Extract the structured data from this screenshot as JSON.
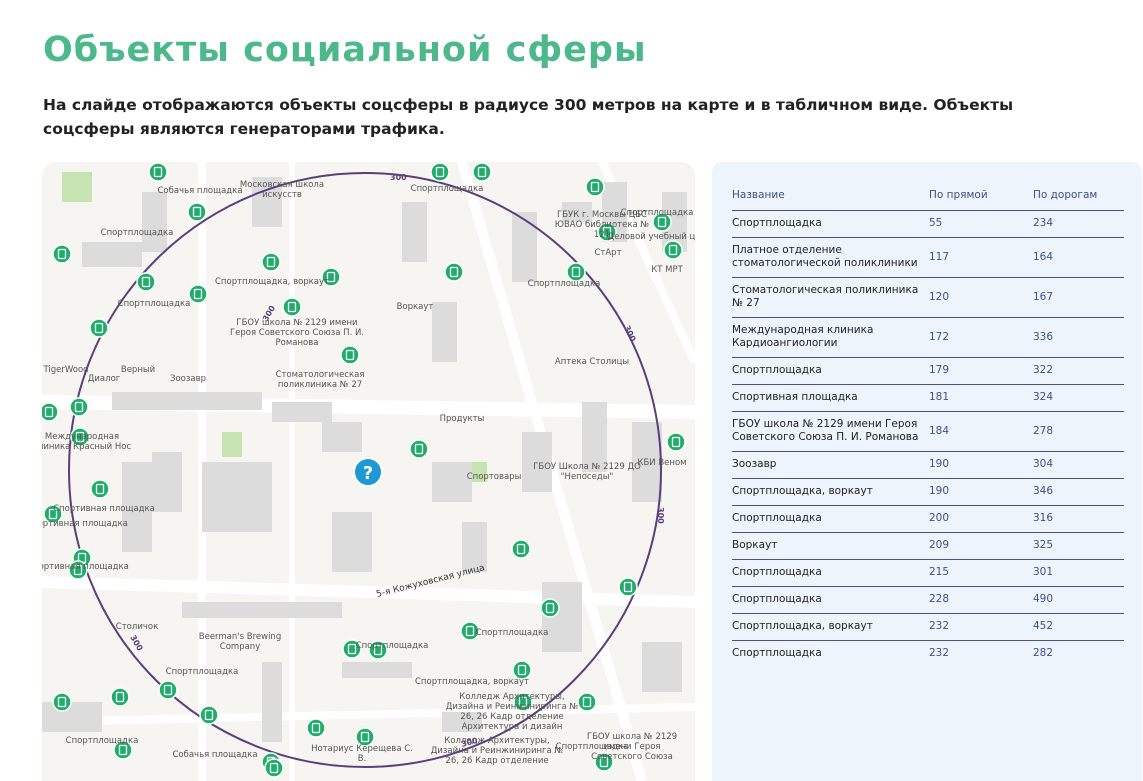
{
  "header": {
    "title": "Объекты социальной сферы",
    "subtitle": "На слайде отображаются объекты соцсферы в радиусе 300 метров на карте и в табличном виде. Объекты соцсферы являются генераторами трафика."
  },
  "map": {
    "radius_label": "300",
    "street": "5-я Кожуховская улица",
    "labels": [
      "Собачья площадка",
      "Московская школа искусств",
      "Спортплощадка",
      "ГБУК г. Москвы ЦБС ЮВАО библиотека № 121",
      "Спортплощадка",
      "Деловой учебный центр",
      "СтАрт",
      "КТ МРТ",
      "Спортплощадка",
      "Спортплощадка, воркаут",
      "Спортплощадка",
      "Воркаут",
      "Спортплощадка",
      "ГБОУ школа № 2129 имени Героя Советского Союза П. И. Романова",
      "Стоматологическая поликлиника № 27",
      "Зоозавр",
      "Диалог",
      "Верный",
      "TigerWood",
      "Аптека Столицы",
      "Продукты",
      "Международная клиника Красный Нос",
      "КБИ Веном",
      "Спортовары",
      "ГБОУ Школа № 2129 ДО \"Непоседы\"",
      "Спортивная площадка",
      "Спортивная площадка",
      "Спортивная площадка",
      "Столичок",
      "Beerman's Brewing Company",
      "Спортплощадка",
      "Спортплощадка",
      "Спортплощадка, воркаут",
      "Спортплощадка",
      "Колледж Архитектуры, Дизайна и Реинжиниринга № 26, 26 Кадр отделение Архитектура и дизайн",
      "Спортплощадка",
      "Собачья площадка",
      "Нотариус Керещева С. В.",
      "Спортплощадка",
      "Колледж Архитектуры, Дизайна и Реинжиниринга № 26, 26 Кадр отделение",
      "ГБОУ школа № 2129 имени Героя Советского Союза"
    ]
  },
  "table": {
    "headers": [
      "Название",
      "По прямой",
      "По дорогам"
    ],
    "rows": [
      {
        "name": "Спортплощадка",
        "direct": "55",
        "road": "234"
      },
      {
        "name": "Платное отделение стоматологической поликлиники",
        "direct": "117",
        "road": "164"
      },
      {
        "name": "Стоматологическая поликлиника № 27",
        "direct": "120",
        "road": "167"
      },
      {
        "name": "Международная клиника Кардиоангиологии",
        "direct": "172",
        "road": "336"
      },
      {
        "name": "Спортплощадка",
        "direct": "179",
        "road": "322"
      },
      {
        "name": "Спортивная площадка",
        "direct": "181",
        "road": "324"
      },
      {
        "name": "ГБОУ школа № 2129 имени Героя Советского Союза П. И. Романова",
        "direct": "184",
        "road": "278"
      },
      {
        "name": "Зоозавр",
        "direct": "190",
        "road": "304"
      },
      {
        "name": "Спортплощадка, воркаут",
        "direct": "190",
        "road": "346"
      },
      {
        "name": "Спортплощадка",
        "direct": "200",
        "road": "316"
      },
      {
        "name": "Воркаут",
        "direct": "209",
        "road": "325"
      },
      {
        "name": "Спортплощадка",
        "direct": "215",
        "road": "301"
      },
      {
        "name": "Спортплощадка",
        "direct": "228",
        "road": "490"
      },
      {
        "name": "Спортплощадка, воркаут",
        "direct": "232",
        "road": "452"
      },
      {
        "name": "Спортплощадка",
        "direct": "232",
        "road": "282"
      }
    ]
  },
  "colors": {
    "title": "#4db88c",
    "marker": "#1fae6a",
    "circle": "#5b3f7d",
    "center": "#1d9ad6"
  }
}
